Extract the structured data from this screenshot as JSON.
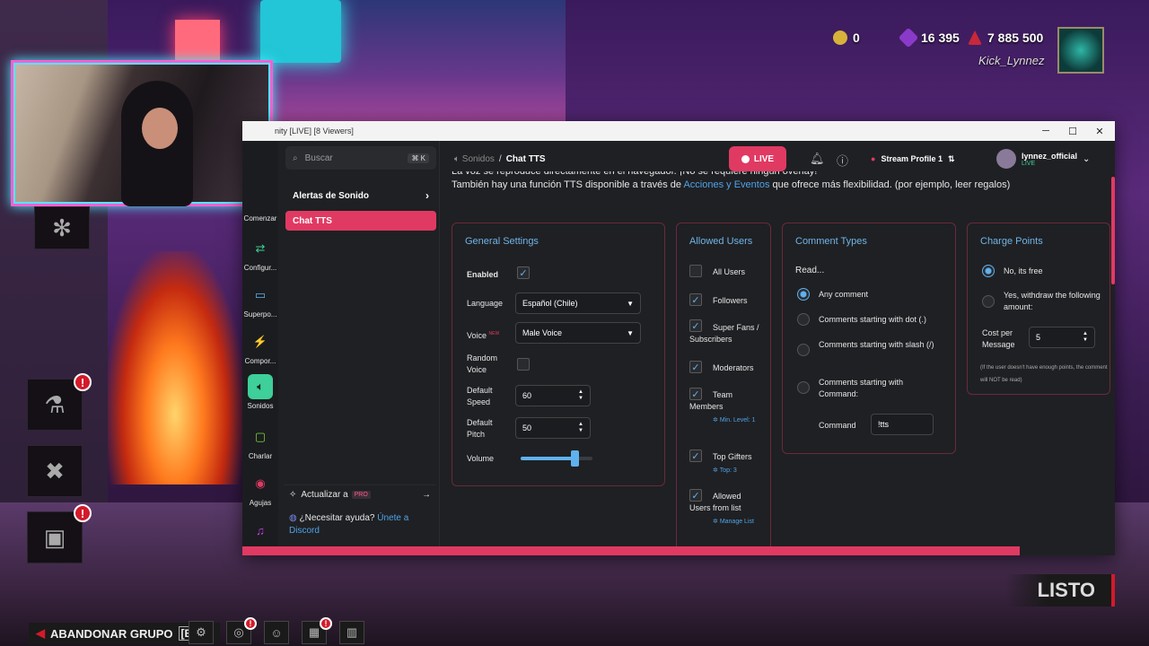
{
  "hud": {
    "currency1": "0",
    "currency2": "16 395",
    "currency3": "7 885 500",
    "username": "Kick_Lynnez"
  },
  "window": {
    "title": "nity [LIVE] [8 Viewers]"
  },
  "rail": [
    {
      "label": "Comenzar"
    },
    {
      "label": "Configur..."
    },
    {
      "label": "Superpo..."
    },
    {
      "label": "Compor..."
    },
    {
      "label": "Sonidos"
    },
    {
      "label": "Charlar"
    },
    {
      "label": "Agujas"
    }
  ],
  "sidebar": {
    "search_placeholder": "Buscar",
    "search_kbd": "⌘ K",
    "items": [
      {
        "label": "Alertas de Sonido"
      },
      {
        "label": "Chat TTS"
      }
    ],
    "update_label": "Actualizar a",
    "update_badge": "PRO",
    "help_text": "¿Necesitar ayuda?",
    "help_link": "Únete a Discord"
  },
  "topbar": {
    "crumb_parent": "Sonidos",
    "crumb_sep": "/",
    "crumb_current": "Chat TTS",
    "live_label": "LIVE",
    "notif_count": "4",
    "profile_label": "Stream Profile 1",
    "user_name": "lynnez_official",
    "user_status": "LIVE"
  },
  "intro": {
    "line1": "La voz se reproduce directamente en el navegador. ¡No se requiere ningún overlay!",
    "line2_pre": "También hay una función TTS disponible a través de ",
    "line2_link": "Acciones y Eventos",
    "line2_post": " que ofrece más flexibilidad. (por ejemplo, leer regalos)"
  },
  "general": {
    "title": "General Settings",
    "enabled_label": "Enabled",
    "language_label": "Language",
    "language_value": "Español (Chile)",
    "voice_label": "Voice",
    "voice_badge": "NEW",
    "voice_value": "Male Voice",
    "random_voice_label": "Random Voice",
    "speed_label": "Default Speed",
    "speed_value": "60",
    "pitch_label": "Default Pitch",
    "pitch_value": "50",
    "volume_label": "Volume",
    "volume_level": 0.75
  },
  "allowed": {
    "title": "Allowed Users",
    "items": [
      {
        "label": "All Users",
        "checked": false
      },
      {
        "label": "Followers",
        "checked": true
      },
      {
        "label": "Super Fans / Subscribers",
        "checked": true
      },
      {
        "label": "Moderators",
        "checked": true
      },
      {
        "label": "Team Members",
        "checked": true,
        "sub": "Min. Level: 1"
      },
      {
        "label": "Top Gifters",
        "checked": true,
        "sub": "Top: 3"
      },
      {
        "label": "Allowed Users from list",
        "checked": true,
        "sub": "Manage List"
      }
    ]
  },
  "comments": {
    "title": "Comment Types",
    "read_label": "Read...",
    "options": [
      {
        "label": "Any comment",
        "selected": true
      },
      {
        "label": "Comments starting with dot (.)",
        "selected": false
      },
      {
        "label": "Comments starting with slash (/)",
        "selected": false
      },
      {
        "label": "Comments starting with Command:",
        "selected": false
      }
    ],
    "command_label": "Command",
    "command_value": "!tts"
  },
  "charge": {
    "title": "Charge Points",
    "options": [
      {
        "label": "No, its free",
        "selected": true
      },
      {
        "label": "Yes, withdraw the following amount:",
        "selected": false
      }
    ],
    "cost_label": "Cost per Message",
    "cost_value": "5",
    "note": "(If the user doesn't have enough points, the comment will NOT be read)"
  },
  "game": {
    "listo": "LISTO",
    "abandon": "ABANDONAR GRUPO",
    "esc": "[ESC]"
  }
}
